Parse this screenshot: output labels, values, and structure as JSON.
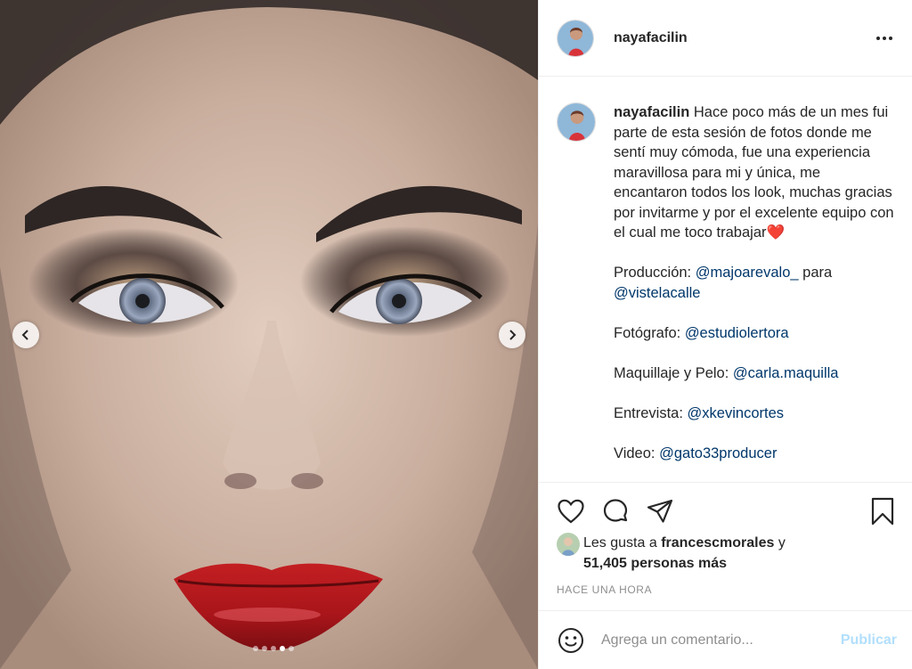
{
  "post": {
    "username": "nayafacilin",
    "more_icon": "more-horizontal-icon"
  },
  "caption": {
    "username": "nayafacilin",
    "intro": "Hace poco más de un mes fui parte de esta sesión de fotos donde me sentí muy cómoda, fue una experiencia maravillosa para mi y única, me encantaron todos los look, muchas gracias por invitarme y por el excelente equipo con el cual me toco trabajar❤️",
    "produccion_label": "Producción:",
    "produccion_mention": "@majoarevalo_",
    "produccion_connector": "para",
    "produccion_mention2": "@vistelacalle",
    "fotografo_label": "Fotógrafo:",
    "fotografo_mention": "@estudiolertora",
    "maquillaje_label": "Maquillaje y Pelo:",
    "maquillaje_mention": "@carla.maquilla",
    "entrevista_label": "Entrevista:",
    "entrevista_mention": "@xkevincortes",
    "video_label": "Video:",
    "video_mention": "@gato33producer"
  },
  "carousel": {
    "total": 5,
    "active_index": 3
  },
  "likes": {
    "prefix": "Les gusta a",
    "user": "francescmorales",
    "connector": "y",
    "others": "51,405 personas más"
  },
  "timestamp": "HACE UNA HORA",
  "comment": {
    "placeholder": "Agrega un comentario...",
    "post_label": "Publicar"
  },
  "colors": {
    "mention": "#00376b",
    "muted": "#8e8e8e",
    "post_disabled": "#b2dffc",
    "text": "#262626"
  }
}
